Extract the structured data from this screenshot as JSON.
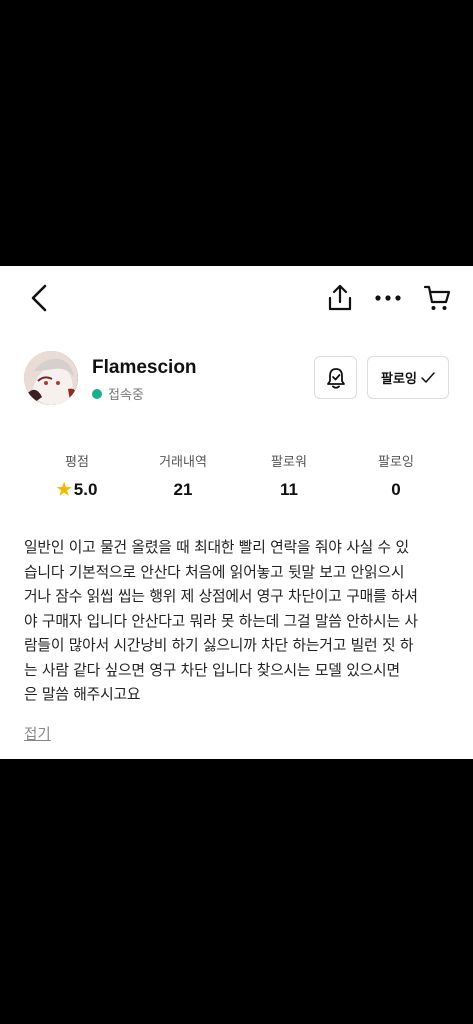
{
  "header": {
    "back_icon": "chevron-left-icon",
    "share_icon": "share-icon",
    "more_icon": "more-horizontal-icon",
    "cart_icon": "cart-icon"
  },
  "profile": {
    "username": "Flamescion",
    "status": "접속중",
    "status_color": "#17b08a",
    "alarm_icon": "bell-check-icon",
    "follow_label": "팔로잉"
  },
  "stats": [
    {
      "label": "평점",
      "value": "5.0"
    },
    {
      "label": "거래내역",
      "value": "21"
    },
    {
      "label": "팔로워",
      "value": "11"
    },
    {
      "label": "팔로잉",
      "value": "0"
    }
  ],
  "description": [
    "일반인 이고 물건 올렸을 때 최대한 빨리 연락을 줘야 사실 수 있",
    "습니다 기본적으로 안산다 처음에 읽어놓고 뒷말 보고 안읽으시",
    "거나 잠수 읽씹 씹는 행위 제 상점에서 영구 차단이고 구매를 하셔",
    "야 구매자 입니다 안산다고 뭐라 못 하는데 그걸 말씀 안하시는 사",
    "람들이 많아서 시간낭비 하기 싫으니까 차단 하는거고 빌런 짓 하",
    "는 사람 같다 싶으면 영구 차단 입니다  찾으시는 모델  있으시면",
    "은 말씀 해주시고요"
  ],
  "fold_label": "접기"
}
